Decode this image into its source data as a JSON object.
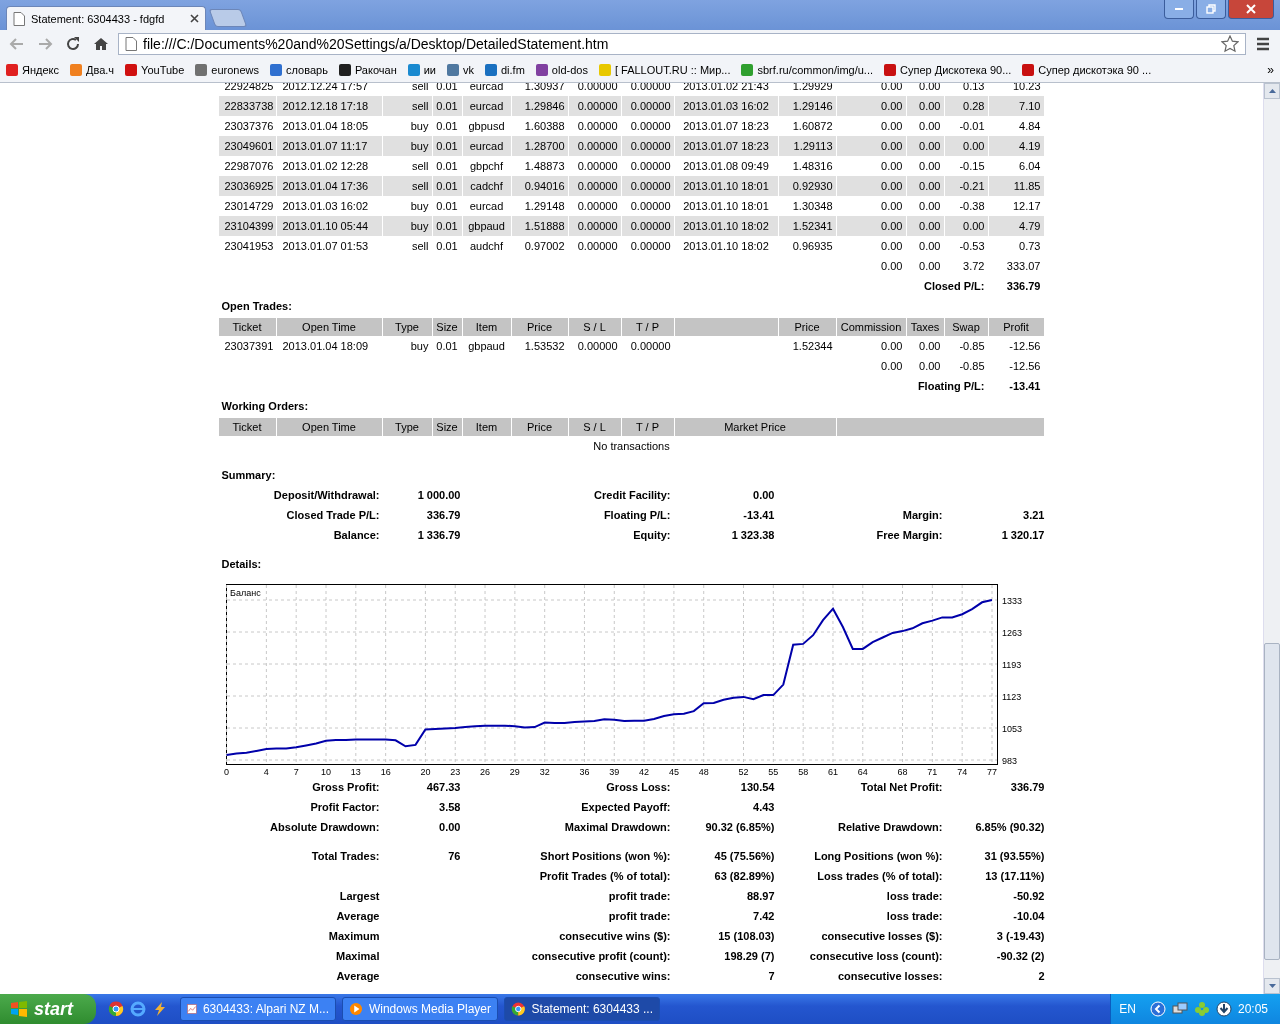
{
  "browser": {
    "tabs": [
      {
        "title": "Statement: 6304433 - fdgfd",
        "selected": true
      }
    ],
    "address": "file:///C:/Documents%20and%20Settings/a/Desktop/DetailedStatement.htm",
    "bookmarks": [
      {
        "label": "Яндекс",
        "color": "#e02020"
      },
      {
        "label": "Два.ч",
        "color": "#f08020"
      },
      {
        "label": "YouTube",
        "color": "#d01010"
      },
      {
        "label": "euronews",
        "color": "#707070"
      },
      {
        "label": "словарь",
        "color": "#3070d0"
      },
      {
        "label": "Ракочан",
        "color": "#202020"
      },
      {
        "label": "ии",
        "color": "#1a8ad0"
      },
      {
        "label": "vk",
        "color": "#5078a0"
      },
      {
        "label": "di.fm",
        "color": "#1a70c0"
      },
      {
        "label": "old-dos",
        "color": "#8040a0"
      },
      {
        "label": "[ FALLOUT.RU :: Мир...",
        "color": "#e8c800"
      },
      {
        "label": "sbrf.ru/common/img/u...",
        "color": "#30a030"
      },
      {
        "label": "Супер Дискотека 90...",
        "color": "#c81010"
      },
      {
        "label": "Супер дискотэка 90 ...",
        "color": "#c81010"
      }
    ],
    "overflow": "»"
  },
  "closed_trades": {
    "rows": [
      [
        "22924825",
        "2012.12.24 17:57",
        "sell",
        "0.01",
        "eurcad",
        "1.30937",
        "0.00000",
        "0.00000",
        "2013.01.02 21:43",
        "1.29929",
        "0.00",
        "0.00",
        "0.13",
        "10.23"
      ],
      [
        "22833738",
        "2012.12.18 17:18",
        "sell",
        "0.01",
        "eurcad",
        "1.29846",
        "0.00000",
        "0.00000",
        "2013.01.03 16:02",
        "1.29146",
        "0.00",
        "0.00",
        "0.28",
        "7.10"
      ],
      [
        "23037376",
        "2013.01.04 18:05",
        "buy",
        "0.01",
        "gbpusd",
        "1.60388",
        "0.00000",
        "0.00000",
        "2013.01.07 18:23",
        "1.60872",
        "0.00",
        "0.00",
        "-0.01",
        "4.84"
      ],
      [
        "23049601",
        "2013.01.07 11:17",
        "buy",
        "0.01",
        "eurcad",
        "1.28700",
        "0.00000",
        "0.00000",
        "2013.01.07 18:23",
        "1.29113",
        "0.00",
        "0.00",
        "0.00",
        "4.19"
      ],
      [
        "22987076",
        "2013.01.02 12:28",
        "sell",
        "0.01",
        "gbpchf",
        "1.48873",
        "0.00000",
        "0.00000",
        "2013.01.08 09:49",
        "1.48316",
        "0.00",
        "0.00",
        "-0.15",
        "6.04"
      ],
      [
        "23036925",
        "2013.01.04 17:36",
        "sell",
        "0.01",
        "cadchf",
        "0.94016",
        "0.00000",
        "0.00000",
        "2013.01.10 18:01",
        "0.92930",
        "0.00",
        "0.00",
        "-0.21",
        "11.85"
      ],
      [
        "23014729",
        "2013.01.03 16:02",
        "buy",
        "0.01",
        "eurcad",
        "1.29148",
        "0.00000",
        "0.00000",
        "2013.01.10 18:01",
        "1.30348",
        "0.00",
        "0.00",
        "-0.38",
        "12.17"
      ],
      [
        "23104399",
        "2013.01.10 05:44",
        "buy",
        "0.01",
        "gbpaud",
        "1.51888",
        "0.00000",
        "0.00000",
        "2013.01.10 18:02",
        "1.52341",
        "0.00",
        "0.00",
        "0.00",
        "4.79"
      ],
      [
        "23041953",
        "2013.01.07 01:53",
        "sell",
        "0.01",
        "audchf",
        "0.97002",
        "0.00000",
        "0.00000",
        "2013.01.10 18:02",
        "0.96935",
        "0.00",
        "0.00",
        "-0.53",
        "0.73"
      ]
    ],
    "totals": [
      "0.00",
      "0.00",
      "3.72",
      "333.07"
    ],
    "result": {
      "label": "Closed P/L:",
      "value": "336.79"
    }
  },
  "open_trades": {
    "title": "Open Trades:",
    "columns": [
      "Ticket",
      "Open Time",
      "Type",
      "Size",
      "Item",
      "Price",
      "S / L",
      "T / P",
      "Price",
      "Commission",
      "Taxes",
      "Swap",
      "Profit"
    ],
    "rows": [
      [
        "23037391",
        "2013.01.04 18:09",
        "buy",
        "0.01",
        "gbpaud",
        "1.53532",
        "0.00000",
        "0.00000",
        "1.52344",
        "0.00",
        "0.00",
        "-0.85",
        "-12.56"
      ]
    ],
    "totals": [
      "0.00",
      "0.00",
      "-0.85",
      "-12.56"
    ],
    "result": {
      "label": "Floating P/L:",
      "value": "-13.41"
    }
  },
  "working_orders": {
    "title": "Working Orders:",
    "columns": [
      "Ticket",
      "Open Time",
      "Type",
      "Size",
      "Item",
      "Price",
      "S / L",
      "T / P",
      "Market Price"
    ],
    "empty_text": "No transactions"
  },
  "summary": {
    "title": "Summary:",
    "rows": [
      {
        "left": {
          "label": "Deposit/Withdrawal:",
          "value": "1 000.00"
        },
        "middle": {
          "label": "Credit Facility:",
          "value": "0.00"
        }
      },
      {
        "left": {
          "label": "Closed Trade P/L:",
          "value": "336.79"
        },
        "middle": {
          "label": "Floating P/L:",
          "value": "-13.41"
        },
        "right": {
          "label": "Margin:",
          "value": "3.21"
        }
      },
      {
        "left": {
          "label": "Balance:",
          "value": "1 336.79"
        },
        "middle": {
          "label": "Equity:",
          "value": "1 323.38"
        },
        "right": {
          "label": "Free Margin:",
          "value": "1 320.17"
        }
      }
    ]
  },
  "details": {
    "title": "Details:",
    "chart_data": {
      "type": "line",
      "title": "Баланс",
      "grid": true,
      "x": [
        0,
        1,
        2,
        3,
        4,
        5,
        6,
        7,
        8,
        9,
        10,
        11,
        12,
        13,
        14,
        15,
        16,
        17,
        18,
        19,
        20,
        21,
        22,
        23,
        24,
        25,
        26,
        27,
        28,
        29,
        30,
        31,
        32,
        33,
        34,
        35,
        36,
        37,
        38,
        39,
        40,
        41,
        42,
        43,
        44,
        45,
        46,
        47,
        48,
        49,
        50,
        51,
        52,
        53,
        54,
        55,
        56,
        57,
        58,
        59,
        60,
        61,
        62,
        63,
        64,
        65,
        66,
        67,
        68,
        69,
        70,
        71,
        72,
        73,
        74,
        75,
        76,
        77
      ],
      "series": [
        {
          "color": "#0000aa",
          "values": [
            994,
            997,
            999,
            1003,
            1007,
            1008,
            1008,
            1011,
            1015,
            1019,
            1025,
            1027,
            1027,
            1028,
            1028,
            1028,
            1028,
            1026,
            1013,
            1016,
            1050,
            1051,
            1052,
            1053,
            1055,
            1057,
            1058,
            1058,
            1058,
            1057,
            1054,
            1055,
            1065,
            1064,
            1064,
            1066,
            1067,
            1068,
            1072,
            1071,
            1068,
            1069,
            1069,
            1073,
            1079,
            1083,
            1084,
            1090,
            1107,
            1108,
            1115,
            1119,
            1121,
            1116,
            1125,
            1125,
            1148,
            1235,
            1237,
            1256,
            1289,
            1314,
            1274,
            1226,
            1226,
            1241,
            1251,
            1261,
            1265,
            1271,
            1282,
            1288,
            1295,
            1295,
            1302,
            1313,
            1328,
            1333
          ]
        }
      ],
      "xlim": [
        0,
        77
      ],
      "ylim": [
        983,
        1333
      ],
      "xticks": [
        0,
        4,
        7,
        10,
        13,
        16,
        20,
        23,
        26,
        29,
        32,
        36,
        39,
        42,
        45,
        48,
        52,
        55,
        58,
        61,
        64,
        68,
        71,
        74,
        77
      ],
      "yticks": [
        983,
        1053,
        1123,
        1193,
        1263,
        1333
      ]
    },
    "groups": [
      [
        {
          "left": {
            "label": "Gross Profit:",
            "value": "467.33"
          },
          "middle": {
            "label": "Gross Loss:",
            "value": "130.54"
          },
          "right": {
            "label": "Total Net Profit:",
            "value": "336.79"
          }
        },
        {
          "left": {
            "label": "Profit Factor:",
            "value": "3.58"
          },
          "middle": {
            "label": "Expected Payoff:",
            "value": "4.43"
          }
        },
        {
          "left": {
            "label": "Absolute Drawdown:",
            "value": "0.00"
          },
          "middle": {
            "label": "Maximal Drawdown:",
            "value": "90.32 (6.85%)"
          },
          "right": {
            "label": "Relative Drawdown:",
            "value": "6.85% (90.32)"
          }
        }
      ],
      [
        {
          "left": {
            "label": "Total Trades:",
            "value": "76"
          },
          "middle": {
            "label": "Short Positions (won %):",
            "value": "45 (75.56%)"
          },
          "right": {
            "label": "Long Positions (won %):",
            "value": "31 (93.55%)"
          }
        },
        {
          "middle": {
            "label": "Profit Trades (% of total):",
            "value": "63 (82.89%)"
          },
          "right": {
            "label": "Loss trades (% of total):",
            "value": "13 (17.11%)"
          }
        },
        {
          "left": {
            "label": "Largest"
          },
          "middle": {
            "label": "profit trade:",
            "value": "88.97"
          },
          "right": {
            "label": "loss trade:",
            "value": "-50.92"
          }
        },
        {
          "left": {
            "label": "Average"
          },
          "middle": {
            "label": "profit trade:",
            "value": "7.42"
          },
          "right": {
            "label": "loss trade:",
            "value": "-10.04"
          }
        },
        {
          "left": {
            "label": "Maximum"
          },
          "middle": {
            "label": "consecutive wins ($):",
            "value": "15 (108.03)"
          },
          "right": {
            "label": "consecutive losses ($):",
            "value": "3 (-19.43)"
          }
        },
        {
          "left": {
            "label": "Maximal"
          },
          "middle": {
            "label": "consecutive profit (count):",
            "value": "198.29 (7)"
          },
          "right": {
            "label": "consecutive loss (count):",
            "value": "-90.32 (2)"
          }
        },
        {
          "left": {
            "label": "Average"
          },
          "middle": {
            "label": "consecutive wins:",
            "value": "7"
          },
          "right": {
            "label": "consecutive losses:",
            "value": "2"
          }
        }
      ]
    ]
  },
  "taskbar": {
    "start": "start",
    "tasks": [
      {
        "label": "6304433: Alpari NZ M...",
        "selected": false
      },
      {
        "label": "Windows Media Player",
        "selected": false
      },
      {
        "label": "Statement: 6304433 ...",
        "selected": true
      }
    ],
    "language": "EN",
    "clock": "20:05"
  }
}
